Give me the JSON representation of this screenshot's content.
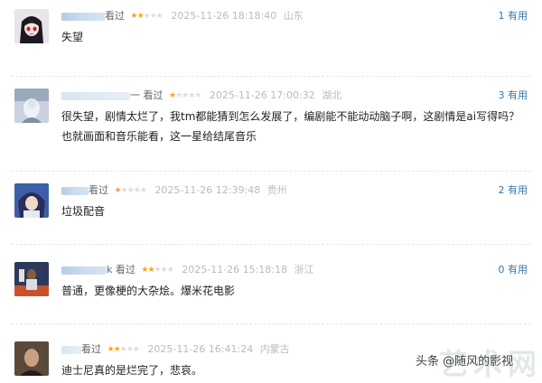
{
  "reviews": [
    {
      "user_suffix": "看过",
      "rating": 2,
      "time": "2025-11-26 18:18:40",
      "location": "山东",
      "useful_count": "1",
      "useful_label": "有用",
      "content": "失望"
    },
    {
      "user_suffix": "一 看过",
      "rating": 1,
      "time": "2025-11-26 17:00:32",
      "location": "湖北",
      "useful_count": "3",
      "useful_label": "有用",
      "content": "很失望，剧情太烂了，我tm都能猜到怎么发展了，编剧能不能动动脑子啊，这剧情是ai写得吗？也就画面和音乐能看，这一星给结尾音乐"
    },
    {
      "user_suffix": "看过",
      "rating": 1,
      "time": "2025-11-26 12:39:48",
      "location": "贵州",
      "useful_count": "2",
      "useful_label": "有用",
      "content": "垃圾配音"
    },
    {
      "user_suffix": "k 看过",
      "rating": 2,
      "time": "2025-11-26 15:18:18",
      "location": "浙江",
      "useful_count": "0",
      "useful_label": "有用",
      "content": "普通，更像梗的大杂烩。爆米花电影"
    },
    {
      "user_suffix": "看过",
      "rating": 2,
      "time": "2025-11-26 16:41:24",
      "location": "内蒙古",
      "useful_count": "",
      "useful_label": "",
      "content": "迪士尼真的是烂完了，悲哀。"
    }
  ],
  "watermark": "头条 @随风的影视",
  "colors": {
    "star": "#f5a623",
    "useful": "#3377aa"
  }
}
